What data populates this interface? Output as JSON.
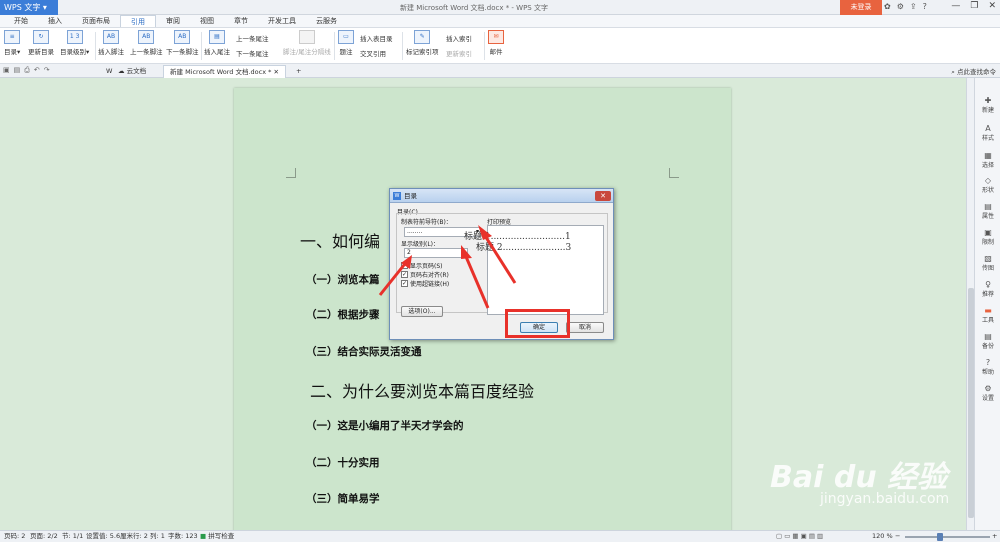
{
  "titlebar": {
    "app_name": "WPS 文字",
    "doc_title": "新建 Microsoft Word 文档.docx * - WPS 文字",
    "login": "未登录"
  },
  "menus": [
    "开始",
    "插入",
    "页面布局",
    "引用",
    "审阅",
    "视图",
    "章节",
    "开发工具",
    "云服务"
  ],
  "ribbon": {
    "toc": "目录",
    "update_toc": "更新目录",
    "toc_level": "目录级别",
    "footnote": "插入脚注",
    "prev_footnote": "上一条脚注",
    "next_footnote": "下一条脚注",
    "endnote": "插入尾注",
    "prev_endnote": "上一条尾注",
    "next_endnote": "下一条尾注",
    "separator": "脚注/尾注分隔线",
    "caption": "题注",
    "insert_toc_table": "插入表目录",
    "cross_ref": "交叉引用",
    "mark_index": "标记索引项",
    "insert_index": "插入索引",
    "update_index": "更新索引",
    "mail": "邮件"
  },
  "tabs": {
    "cloud": "云文档",
    "doc": "新建 Microsoft Word 文档.docx *",
    "find": "点此查找命令"
  },
  "document": {
    "h1_a": "一、如何编",
    "h2_a1": "（一）浏览本篇",
    "h2_a2": "（二）根据步骤",
    "h2_a3": "（三）结合实际灵活变通",
    "h1_b": "二、为什么要浏览本篇百度经验",
    "h2_b1": "（一）这是小编用了半天才学会的",
    "h2_b2": "（二）十分实用",
    "h2_b3": "（三）简单易学"
  },
  "dialog": {
    "title": "目录",
    "group": "目录(C)",
    "leader_label": "制表符前导符(B)：",
    "leader_value": "........",
    "preview_label": "打印预览",
    "level_label": "显示级别(L)：",
    "level_value": "2",
    "show_page": "显示页码(S)",
    "right_align": "页码右对齐(R)",
    "hyperlink": "使用超链接(H)",
    "options": "选项(O)...",
    "ok": "确定",
    "cancel": "取消",
    "preview_1": "标题 1..........................1",
    "preview_2": "标题 2......................3"
  },
  "sidebar": [
    "新建",
    "样式",
    "选择",
    "形状",
    "属性",
    "限制",
    "传图",
    "推荐",
    "工具",
    "备份",
    "帮助",
    "设置"
  ],
  "status": {
    "page": "页码: 2",
    "pages": "页面: 2/2",
    "section": "节: 1/1",
    "setting": "设置值: 5.6厘米",
    "row": "行: 2",
    "col": "列: 1",
    "words": "字数: 123",
    "spell": "拼写检查",
    "zoom": "120 %"
  },
  "watermark": {
    "logo": "Bai du 经验",
    "url": "jingyan.baidu.com"
  },
  "colors": {
    "accent": "#3b7dd8",
    "page_bg": "#cce5cc",
    "highlight": "#e8312a",
    "login": "#e8633f"
  }
}
